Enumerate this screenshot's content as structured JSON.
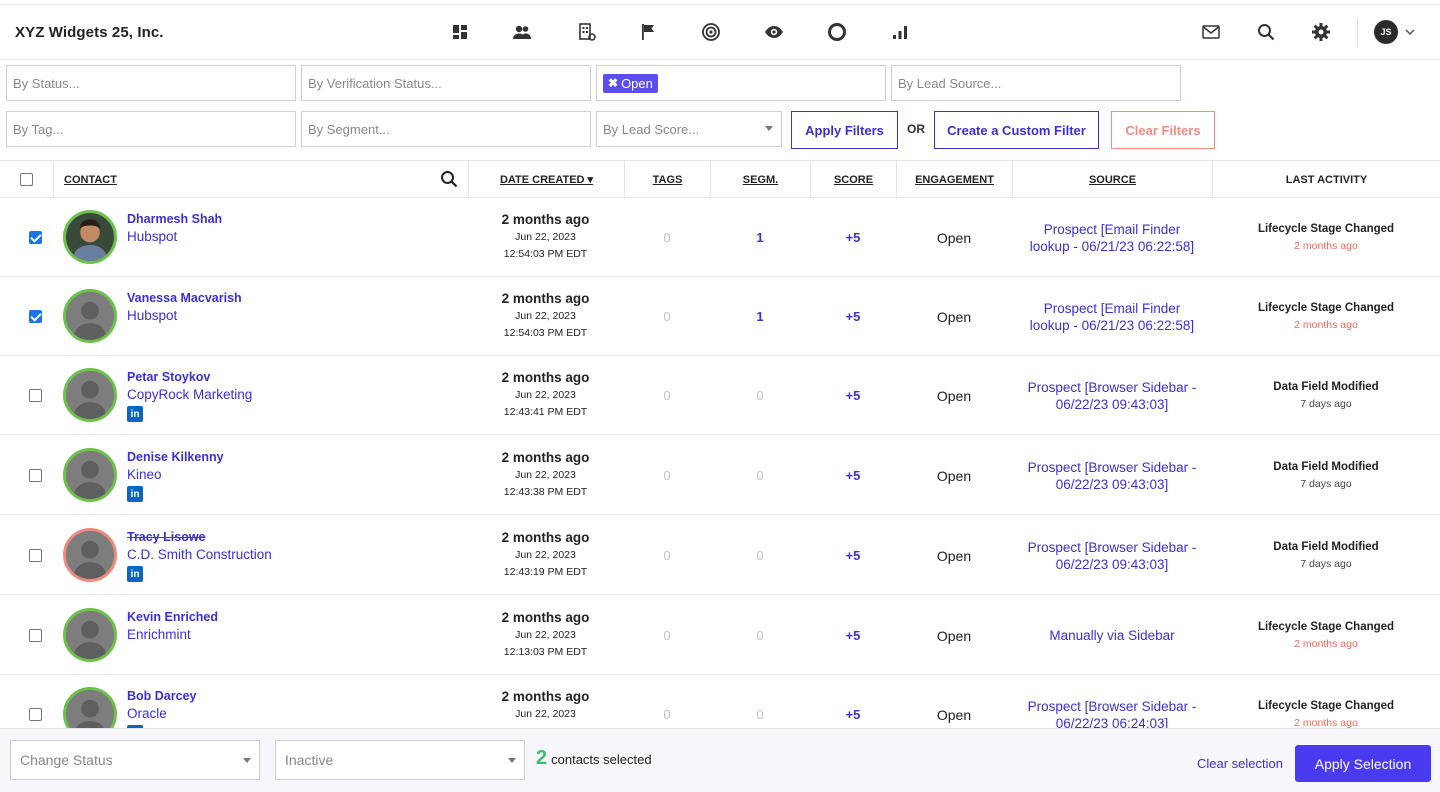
{
  "app": {
    "title": "XYZ Widgets 25, Inc.",
    "user_initials": "JS"
  },
  "nav_icons": [
    "dashboard-icon",
    "contacts-icon",
    "companies-icon",
    "campaigns-flag-icon",
    "target-icon",
    "visitors-eye-icon",
    "circle-icon",
    "reports-bar-icon"
  ],
  "filters": {
    "status_placeholder": "By Status...",
    "verification_placeholder": "By Verification Status...",
    "active_chip": "Open",
    "lead_source_placeholder": "By Lead Source...",
    "tag_placeholder": "By Tag...",
    "segment_placeholder": "By Segment...",
    "lead_score_placeholder": "By Lead Score...",
    "apply_label": "Apply Filters",
    "or_label": "OR",
    "custom_label": "Create a Custom Filter",
    "clear_label": "Clear Filters"
  },
  "table": {
    "headers": {
      "contact": "CONTACT",
      "date_created": "DATE CREATED ▾",
      "tags": "TAGS",
      "segm": "SEGM.",
      "score": "SCORE",
      "engagement": "ENGAGEMENT",
      "source": "SOURCE",
      "last_activity": "LAST ACTIVITY"
    },
    "rows": [
      {
        "name": "Dharmesh Shah",
        "company": "Hubspot",
        "checked": true,
        "linkedin": false,
        "photo": "real",
        "date_rel": "2 months ago",
        "date": "Jun 22, 2023",
        "time": "12:54:03 PM EDT",
        "tags": "0",
        "segm": "1",
        "score": "+5",
        "engagement": "Open",
        "source_1": "Prospect [Email Finder",
        "source_2": "lookup - 06/21/23 06:22:58]",
        "activity": "Lifecycle Stage Changed",
        "activity_when": "2 months ago",
        "activity_color": "red"
      },
      {
        "name": "Vanessa Macvarish",
        "company": "Hubspot",
        "checked": true,
        "linkedin": false,
        "photo": "placeholder",
        "date_rel": "2 months ago",
        "date": "Jun 22, 2023",
        "time": "12:54:03 PM EDT",
        "tags": "0",
        "segm": "1",
        "score": "+5",
        "engagement": "Open",
        "source_1": "Prospect [Email Finder",
        "source_2": "lookup - 06/21/23 06:22:58]",
        "activity": "Lifecycle Stage Changed",
        "activity_when": "2 months ago",
        "activity_color": "red"
      },
      {
        "name": "Petar Stoykov",
        "company": "CopyRock Marketing",
        "checked": false,
        "linkedin": true,
        "photo": "placeholder",
        "date_rel": "2 months ago",
        "date": "Jun 22, 2023",
        "time": "12:43:41 PM EDT",
        "tags": "0",
        "segm": "0",
        "score": "+5",
        "engagement": "Open",
        "source_1": "Prospect [Browser Sidebar -",
        "source_2": "06/22/23 09:43:03]",
        "activity": "Data Field Modified",
        "activity_when": "7 days ago",
        "activity_color": "gray"
      },
      {
        "name": "Denise Kilkenny",
        "company": "Kineo",
        "checked": false,
        "linkedin": true,
        "photo": "placeholder",
        "date_rel": "2 months ago",
        "date": "Jun 22, 2023",
        "time": "12:43:38 PM EDT",
        "tags": "0",
        "segm": "0",
        "score": "+5",
        "engagement": "Open",
        "source_1": "Prospect [Browser Sidebar -",
        "source_2": "06/22/23 09:43:03]",
        "activity": "Data Field Modified",
        "activity_when": "7 days ago",
        "activity_color": "gray"
      },
      {
        "name": "Tracy Lisowe",
        "company": "C.D. Smith Construction",
        "checked": false,
        "linkedin": true,
        "photo": "placeholder-red",
        "strike": true,
        "date_rel": "2 months ago",
        "date": "Jun 22, 2023",
        "time": "12:43:19 PM EDT",
        "tags": "0",
        "segm": "0",
        "score": "+5",
        "engagement": "Open",
        "source_1": "Prospect [Browser Sidebar -",
        "source_2": "06/22/23 09:43:03]",
        "activity": "Data Field Modified",
        "activity_when": "7 days ago",
        "activity_color": "gray"
      },
      {
        "name": "Kevin Enriched",
        "company": "Enrichmint",
        "checked": false,
        "linkedin": false,
        "photo": "placeholder",
        "date_rel": "2 months ago",
        "date": "Jun 22, 2023",
        "time": "12:13:03 PM EDT",
        "tags": "0",
        "segm": "0",
        "score": "+5",
        "engagement": "Open",
        "source_1": "Manually via Sidebar",
        "source_2": "",
        "activity": "Lifecycle Stage Changed",
        "activity_when": "2 months ago",
        "activity_color": "red"
      },
      {
        "name": "Bob Darcey",
        "company": "Oracle",
        "checked": false,
        "linkedin": true,
        "photo": "placeholder",
        "date_rel": "2 months ago",
        "date": "Jun 22, 2023",
        "time": "",
        "tags": "0",
        "segm": "0",
        "score": "+5",
        "engagement": "Open",
        "source_1": "Prospect [Browser Sidebar -",
        "source_2": "06/22/23 06:24:03]",
        "activity": "Lifecycle Stage Changed",
        "activity_when": "2 months ago",
        "activity_color": "red"
      }
    ]
  },
  "bulk": {
    "change_status_placeholder": "Change Status",
    "status_value": "Inactive",
    "selected_count": "2",
    "selected_text": "contacts selected",
    "clear_selection": "Clear selection",
    "apply_selection": "Apply Selection"
  },
  "colors": {
    "accent": "#3c2fd6",
    "accent_fill": "#4a3af0",
    "danger": "#f28b82",
    "success": "#3bbf6e",
    "avatar_ring_green": "#6cc24a",
    "avatar_ring_red": "#ef8a80"
  }
}
